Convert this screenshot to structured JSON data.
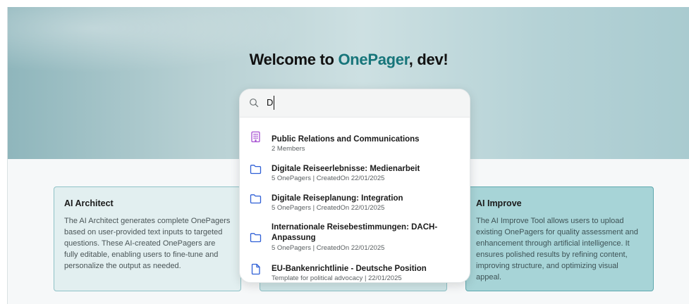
{
  "hero": {
    "welcome_prefix": "Welcome to ",
    "brand": "OnePager",
    "welcome_suffix": ", dev!"
  },
  "search": {
    "query": "D",
    "icon": "search-icon"
  },
  "results": [
    {
      "name": "Public Relations and Communications",
      "meta": "2 Members",
      "icon": "building-icon",
      "icon_color": "#a64fd1"
    },
    {
      "name": "Digitale Reiseerlebnisse: Medienarbeit",
      "meta": "5 OnePagers | CreatedOn 22/01/2025",
      "icon": "folder-icon",
      "icon_color": "#2e5fd6"
    },
    {
      "name": "Digitale Reiseplanung: Integration",
      "meta": "5 OnePagers | CreatedOn 22/01/2025",
      "icon": "folder-icon",
      "icon_color": "#2e5fd6"
    },
    {
      "name": "Internationale Reisebestimmungen: DACH-Anpassung",
      "meta": "5 OnePagers | CreatedOn 22/01/2025",
      "icon": "folder-icon",
      "icon_color": "#2e5fd6"
    },
    {
      "name": "EU-Bankenrichtlinie - Deutsche Position",
      "meta": "Template for political advocacy | 22/01/2025",
      "icon": "document-icon",
      "icon_color": "#2e5fd6"
    }
  ],
  "cards": {
    "left": {
      "title": "AI Architect",
      "body": "The AI Architect generates complete OnePagers based on user-provided text inputs to targeted questions. These AI-created OnePagers are fully editable, enabling users to fine-tune and personalize the output as needed."
    },
    "right": {
      "title": "AI Improve",
      "body": "The AI Improve Tool allows users to upload existing OnePagers for quality assessment and enhancement through artificial intelligence. It ensures polished results by refining content, improving structure, and optimizing visual appeal."
    }
  },
  "colors": {
    "brand": "#17757a"
  }
}
